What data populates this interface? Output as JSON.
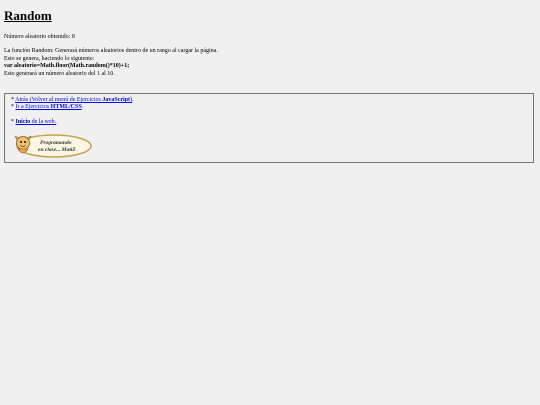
{
  "title": "Random",
  "result": {
    "label": "Número aleatorio obtenido:",
    "value": "8"
  },
  "description": {
    "line1": "La función Random: Generará números aleatorios dentro de un rango al cargar la página.",
    "line2": "Esto se genera, haciendo lo siguiente:",
    "code": "var aleatorio=Math.floor(Math.random()*10)+1;",
    "line4": "Esto generará un número aleatorio del 1 al 10."
  },
  "nav": {
    "bullet": "*",
    "back": {
      "link_text": "Atrás (Volver al menú de Ejercicios ",
      "link_bold": "JavaScript",
      "link_after": ")",
      "tail": "."
    },
    "exercises": {
      "link_text": "Ir a Ejercicios ",
      "link_bold": "HTML/CSS",
      "tail": "."
    },
    "home": {
      "link_bold": "Inicio",
      "tail": " de la web."
    }
  },
  "badge": {
    "line1": "Programando",
    "line2": "en clase... MatiZ",
    "colors": {
      "border": "#c8a050",
      "fill": "#fdf6e3",
      "mascot": "#e8a94a"
    }
  }
}
